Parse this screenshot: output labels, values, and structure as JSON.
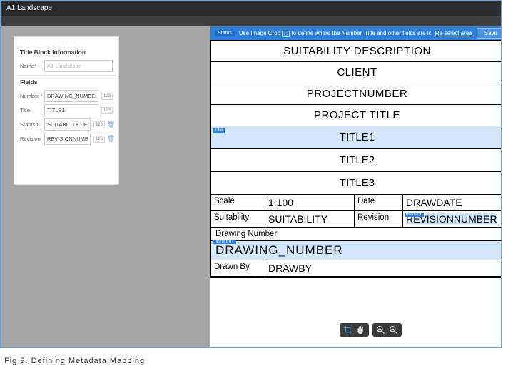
{
  "window": {
    "title": "A1 Landscape"
  },
  "panel": {
    "section1": "Title Block Information",
    "section2": "Fields",
    "name_label": "Name",
    "name_value": "A1 Landscape",
    "fields": [
      {
        "label": "Number",
        "required": true,
        "value": "DRAWING_NUMBER",
        "badge": "123",
        "trash": false
      },
      {
        "label": "Title",
        "required": false,
        "value": "TITLE1",
        "badge": "123",
        "trash": false
      },
      {
        "label": "Status C..",
        "required": false,
        "value": "SUITABILITY DESCRIP...",
        "badge": "123",
        "trash": true
      },
      {
        "label": "Revision",
        "required": false,
        "value": "REVISIONNUMBER",
        "badge": "123",
        "trash": true
      }
    ]
  },
  "bluebar": {
    "status_tag": "Status",
    "msg_pre": "Use Image Crop",
    "msg_post": "to define where the Number, Title and other fields are located",
    "reselect": "Re-select area",
    "save": "Save"
  },
  "titleblock": {
    "rows_top": [
      "SUITABILITY DESCRIPTION",
      "CLIENT",
      "PROJECTNUMBER",
      "PROJECT TITLE"
    ],
    "title_tag": "Title",
    "title_rows": [
      "TITLE1",
      "TITLE2",
      "TITLE3"
    ],
    "scale_lbl": "Scale",
    "scale_val": "1:100",
    "date_lbl": "Date",
    "date_val": "DRAWDATE",
    "suit_lbl": "Suitability",
    "suit_val": "SUITABILITY",
    "rev_lbl": "Revision",
    "rev_tag": "Revision",
    "rev_val": "REVISIONNUMBER",
    "dn_lbl": "Drawing Number",
    "dn_tag": "Number",
    "dn_val": "DRAWING_NUMBER",
    "drawn_lbl": "Drawn By",
    "drawn_val": "DRAWBY"
  },
  "caption": "Fig 9. Defining Metadata Mapping"
}
